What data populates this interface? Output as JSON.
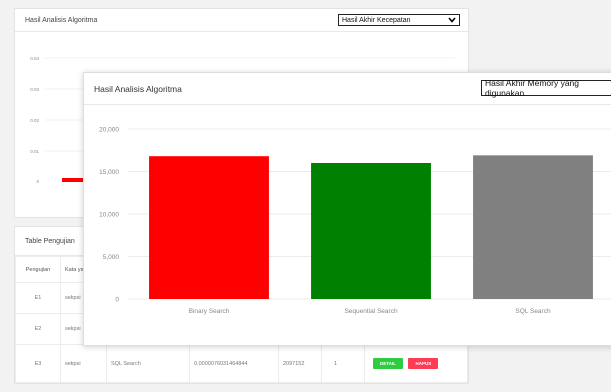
{
  "back_panel": {
    "title": "Hasil Analisis Algoritma",
    "select_value": "Hasil Akhir Kecepatan",
    "y_ticks": [
      "0.04",
      "0.03",
      "0.02",
      "0.01",
      "0"
    ]
  },
  "front_panel": {
    "title": "Hasil Analisis Algoritma",
    "select_value": "Hasil Akhir Memory yang digunakan"
  },
  "table_panel": {
    "title": "Table Pengujian",
    "headers": [
      "Pengujian",
      "Kata ya"
    ],
    "rows": [
      {
        "id": "E1",
        "kata": "sekpsi",
        "metode": "",
        "waktu": "",
        "memory": "",
        "jumlah": ""
      },
      {
        "id": "E2",
        "kata": "sekpsi",
        "metode": "",
        "waktu": "",
        "memory": "",
        "jumlah": ""
      },
      {
        "id": "E3",
        "kata": "sekpsi",
        "metode": "SQL Search",
        "waktu": "0.0000076031464844",
        "memory": "2097152",
        "jumlah": "1"
      }
    ],
    "detail_label": "DETAIL",
    "hapus_label": "HAPUS"
  },
  "colors": {
    "binary": "#ff0000",
    "sequential": "#008000",
    "sql": "#808080",
    "detail_button": "#2ecc40",
    "hapus_button": "#ff3b55"
  },
  "chart_data": {
    "type": "bar",
    "title": "",
    "categories": [
      "Binary Search",
      "Sequential Search",
      "SQL Search"
    ],
    "values": [
      16800,
      16000,
      16900
    ],
    "ylim": [
      0,
      20000
    ],
    "yticks": [
      "0",
      "5,000",
      "10,000",
      "15,000",
      "20,000"
    ],
    "grid": true
  }
}
